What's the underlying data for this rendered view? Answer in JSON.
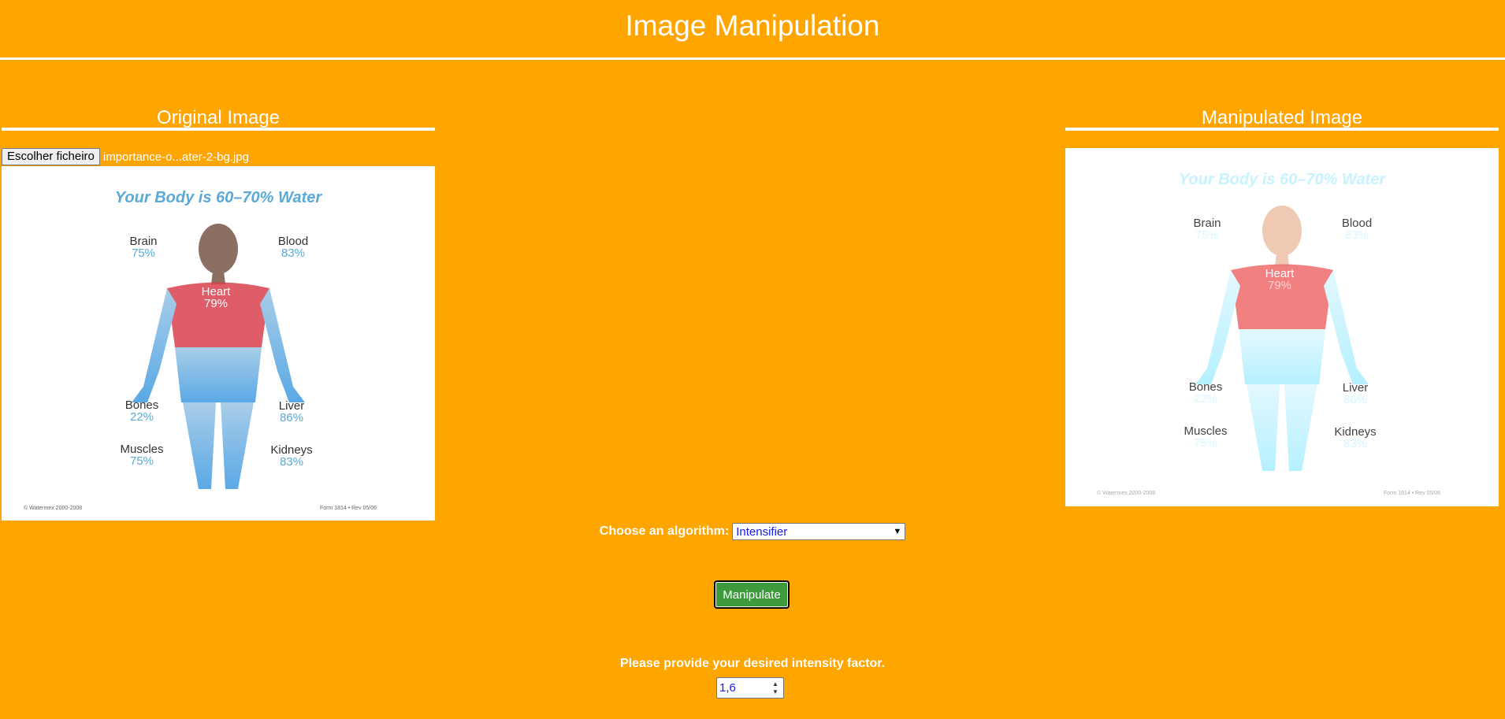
{
  "header": {
    "title": "Image Manipulation"
  },
  "original": {
    "heading": "Original Image",
    "file_button": "Escolher ficheiro",
    "file_name": "importance-o...ater-2-bg.jpg"
  },
  "manipulated": {
    "heading": "Manipulated Image"
  },
  "poster": {
    "title": "Your Body is 60–70% Water",
    "organs": {
      "brain": {
        "name": "Brain",
        "value": "75%"
      },
      "blood": {
        "name": "Blood",
        "value": "83%"
      },
      "heart": {
        "name": "Heart",
        "value": "79%"
      },
      "bones": {
        "name": "Bones",
        "value": "22%"
      },
      "liver": {
        "name": "Liver",
        "value": "86%"
      },
      "muscles": {
        "name": "Muscles",
        "value": "75%"
      },
      "kidneys": {
        "name": "Kidneys",
        "value": "83%"
      }
    },
    "copyright": "© Watermex 2000-2008",
    "form": "Form 1814 • Rev 05/06"
  },
  "controls": {
    "algorithm_label": "Choose an algorithm:",
    "algorithm_selected": "Intensifier",
    "manipulate_button": "Manipulate",
    "intensity_label": "Please provide your desired intensity factor.",
    "intensity_value": "1,6"
  },
  "colors": {
    "background": "#ffa500",
    "button": "#3d9a3d",
    "poster_title": "#5aa9d6",
    "poster_value": "#5aa9d6",
    "heart": "#d9414f"
  }
}
